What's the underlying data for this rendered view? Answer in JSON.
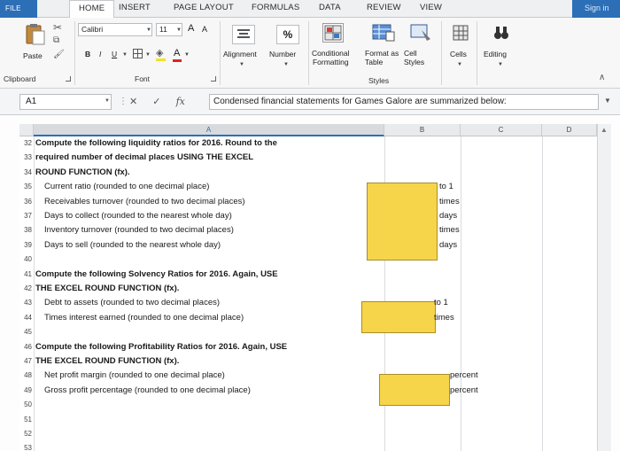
{
  "tabs": [
    "FILE",
    "HOME",
    "INSERT",
    "PAGE LAYOUT",
    "FORMULAS",
    "DATA",
    "REVIEW",
    "VIEW"
  ],
  "signin": "Sign in",
  "ribbon": {
    "paste_label": "Paste",
    "clipboard_label": "Clipboard",
    "font_name": "Calibri",
    "font_size": "11",
    "bold": "B",
    "italic": "I",
    "underline": "U",
    "grow_font": "A",
    "shrink_font": "A",
    "font_color": "A",
    "font_group_label": "Font",
    "alignment_label": "Alignment",
    "number_label": "Number",
    "percent": "%",
    "conditional_formatting": "Conditional\nFormatting",
    "format_as_table": "Format as\nTable",
    "cell_styles": "Cell\nStyles",
    "styles_label": "Styles",
    "cells_label": "Cells",
    "editing_label": "Editing"
  },
  "formula_bar": {
    "name_box": "A1",
    "cancel": "✕",
    "enter": "✓",
    "fx": "fx",
    "content": "Condensed financial statements for Games Galore are summarized below:"
  },
  "columns": [
    "A",
    "B",
    "C",
    "D"
  ],
  "rows": [
    {
      "num": "32",
      "text": "Compute the following liquidity ratios for 2016. Round to the",
      "bold": true,
      "indent": false,
      "unit": ""
    },
    {
      "num": "33",
      "text": "required number of decimal places USING THE EXCEL",
      "bold": true,
      "indent": false,
      "unit": ""
    },
    {
      "num": "34",
      "text": "ROUND FUNCTION (fx).",
      "bold": true,
      "indent": false,
      "unit": ""
    },
    {
      "num": "35",
      "text": "Current ratio (rounded to one decimal place)",
      "bold": false,
      "indent": true,
      "unit": "to 1"
    },
    {
      "num": "36",
      "text": "Receivables turnover (rounded to two decimal places)",
      "bold": false,
      "indent": true,
      "unit": "times"
    },
    {
      "num": "37",
      "text": "Days to collect (rounded to the nearest whole day)",
      "bold": false,
      "indent": true,
      "unit": "days"
    },
    {
      "num": "38",
      "text": "Inventory turnover (rounded to two decimal places)",
      "bold": false,
      "indent": true,
      "unit": "times"
    },
    {
      "num": "39",
      "text": "Days to sell (rounded to the nearest whole day)",
      "bold": false,
      "indent": true,
      "unit": "days"
    },
    {
      "num": "40",
      "text": "",
      "bold": false,
      "indent": false,
      "unit": ""
    },
    {
      "num": "41",
      "text": "Compute the following Solvency Ratios for 2016. Again, USE",
      "bold": true,
      "indent": false,
      "unit": ""
    },
    {
      "num": "42",
      "text": "THE EXCEL ROUND FUNCTION (fx).",
      "bold": true,
      "indent": false,
      "unit": ""
    },
    {
      "num": "43",
      "text": "Debt to assets (rounded to two decimal places)",
      "bold": false,
      "indent": true,
      "unit": "to 1"
    },
    {
      "num": "44",
      "text": "Times interest earned (rounded to one decimal place)",
      "bold": false,
      "indent": true,
      "unit": "times"
    },
    {
      "num": "45",
      "text": "",
      "bold": false,
      "indent": false,
      "unit": ""
    },
    {
      "num": "46",
      "text": "Compute the following Profitability Ratios for 2016. Again, USE",
      "bold": true,
      "indent": false,
      "unit": ""
    },
    {
      "num": "47",
      "text": "THE EXCEL ROUND FUNCTION (fx).",
      "bold": true,
      "indent": false,
      "unit": ""
    },
    {
      "num": "48",
      "text": "Net profit margin (rounded to one decimal place)",
      "bold": false,
      "indent": true,
      "unit": "percent"
    },
    {
      "num": "49",
      "text": "Gross profit percentage (rounded to one decimal place)",
      "bold": false,
      "indent": true,
      "unit": "percent"
    },
    {
      "num": "50",
      "text": "",
      "bold": false,
      "indent": false,
      "unit": ""
    },
    {
      "num": "51",
      "text": "",
      "bold": false,
      "indent": false,
      "unit": ""
    },
    {
      "num": "52",
      "text": "",
      "bold": false,
      "indent": false,
      "unit": ""
    },
    {
      "num": "53",
      "text": "",
      "bold": false,
      "indent": false,
      "unit": ""
    }
  ],
  "colors": {
    "accent": "#2c6fb7",
    "input_cell": "#f6d54a",
    "input_border": "#a78e2c"
  }
}
